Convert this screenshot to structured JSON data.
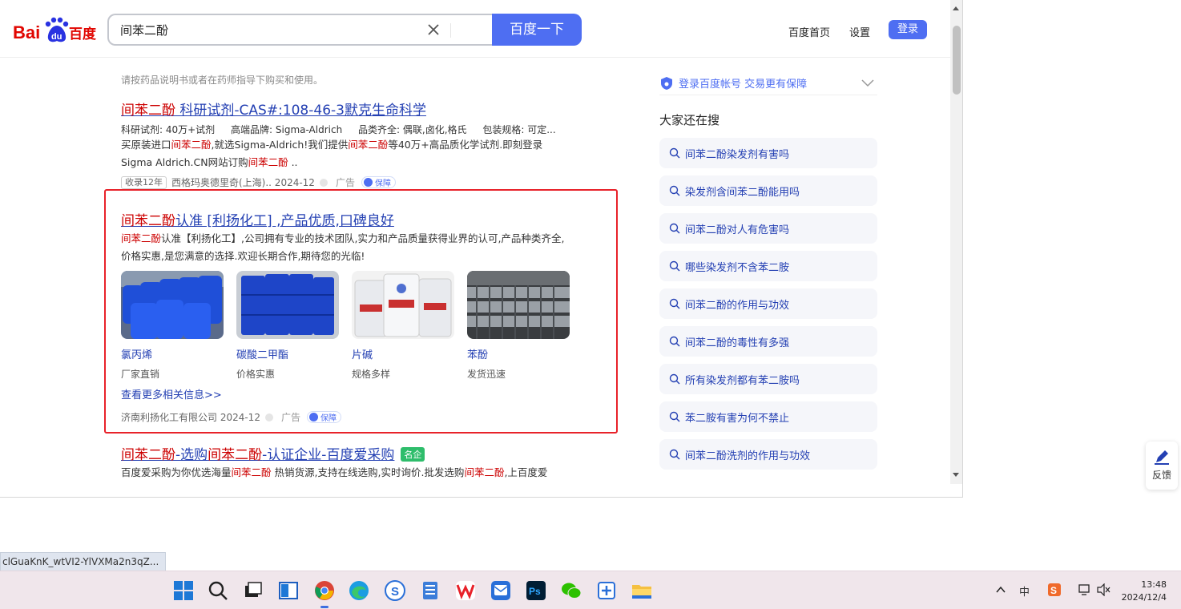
{
  "search": {
    "query": "间苯二酚",
    "button": "百度一下"
  },
  "top_nav": {
    "home": "百度首页",
    "settings": "设置",
    "login": "登录"
  },
  "results": {
    "note": "请按药品说明书或者在药师指导下购买和使用。",
    "r1": {
      "title_hl": "间苯二酚",
      "title_rest": " 科研试剂-CAS#:108-46-3默克生命科学",
      "meta": [
        "科研试剂: 40万+试剂",
        "高端品牌: Sigma-Aldrich",
        "品类齐全: 偶联,卤化,格氏",
        "包装规格: 可定..."
      ],
      "desc_1": "买原装进口",
      "desc_hl_1": "间苯二酚",
      "desc_2": ",就选Sigma-Aldrich!我们提供",
      "desc_hl_2": "间苯二酚",
      "desc_3": "等40万+高品质化学试剂.即刻登录Sigma Aldrich.CN网站订购",
      "desc_hl_3": "间苯二酚",
      "desc_4": " ..",
      "tag": "收录12年",
      "source": "西格玛奥德里奇(上海).. 2024-12",
      "ad": "广告",
      "bao": "保障"
    },
    "r2": {
      "title_hl": "间苯二酚",
      "title_rest": "认准 [利扬化工] ,产品优质,口碑良好",
      "desc_hl": "间苯二酚",
      "desc": "认准【利扬化工】,公司拥有专业的技术团队,实力和产品质量获得业界的认可,产品种类齐全,价格实惠,是您满意的选择.欢迎长期合作,期待您的光临!",
      "products": [
        {
          "name": "氯丙烯",
          "sub": "厂家直销"
        },
        {
          "name": "碳酸二甲酯",
          "sub": "价格实惠"
        },
        {
          "name": "片碱",
          "sub": "规格多样"
        },
        {
          "name": "苯酚",
          "sub": "发货迅速"
        }
      ],
      "more": "查看更多相关信息>>",
      "source": "济南利扬化工有限公司 2024-12",
      "ad": "广告",
      "bao": "保障"
    },
    "r3": {
      "title_hl_1": "间苯二酚",
      "title_mid": "-选购",
      "title_hl_2": "间苯二酚",
      "title_rest": "-认证企业-百度爱采购",
      "badge": "名企",
      "desc_1": "百度爱采购为你优选海量",
      "desc_hl_1": "间苯二酚",
      "desc_2": " 热销货源,支持在线选购,实时询价.批发选购",
      "desc_hl_2": "间苯二酚",
      "desc_3": ",上百度爱"
    }
  },
  "sidebar": {
    "guard": "登录百度帐号 交易更有保障",
    "title": "大家还在搜",
    "items": [
      "间苯二酚染发剂有害吗",
      "染发剂含间苯二酚能用吗",
      "间苯二酚对人有危害吗",
      "哪些染发剂不含苯二胺",
      "间苯二酚的作用与功效",
      "间苯二酚的毒性有多强",
      "所有染发剂都有苯二胺吗",
      "苯二胺有害为何不禁止",
      "间苯二酚洗剂的作用与功效"
    ]
  },
  "feedback": "反馈",
  "status_url": "clGuaKnK_wtVI2-YlVXMa2n3qZ...",
  "taskbar": {
    "icons": [
      "windows-start",
      "search",
      "task-view",
      "widgets",
      "chrome",
      "edge",
      "sogou",
      "notepad",
      "wps",
      "qq-mail",
      "photoshop",
      "wechat",
      "snipping",
      "file-explorer"
    ],
    "tray_ime": "中",
    "time": "13:48",
    "date": "2024/12/4"
  },
  "colors": {
    "brand_blue": "#4e6ef2",
    "link_blue": "#2440b3",
    "highlight_red": "#cc0000",
    "frame_red": "#e8222a"
  }
}
